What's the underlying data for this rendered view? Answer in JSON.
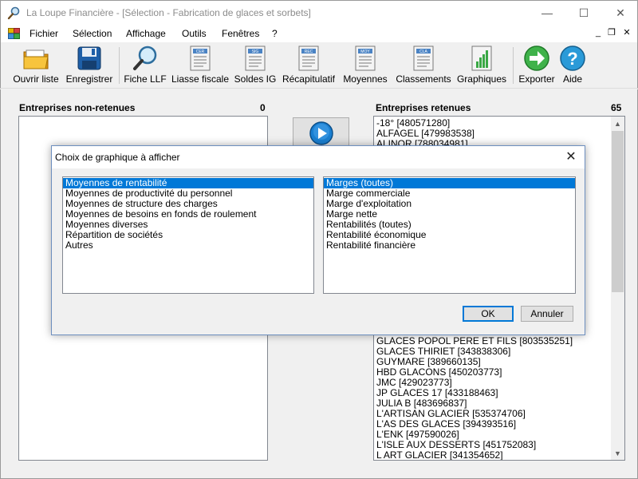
{
  "window": {
    "title": "La Loupe Financière - [Sélection - Fabrication de glaces et sorbets]",
    "minimize": "—",
    "maximize": "☐",
    "close": "✕"
  },
  "menu": {
    "items": [
      "Fichier",
      "Sélection",
      "Affichage",
      "Outils",
      "Fenêtres",
      "?"
    ],
    "mdi_minimize": "_",
    "mdi_restore": "❐",
    "mdi_close": "✕"
  },
  "toolbar": {
    "buttons": [
      {
        "label": "Ouvrir liste",
        "icon": "folder-icon"
      },
      {
        "label": "Enregistrer",
        "icon": "floppy-disk-icon"
      },
      {
        "label": "Fiche LLF",
        "icon": "magnifier-icon"
      },
      {
        "label": "Liasse fiscale",
        "icon": "document-cer-icon"
      },
      {
        "label": "Soldes IG",
        "icon": "document-sig-icon"
      },
      {
        "label": "Récapitulatif",
        "icon": "document-rec-icon"
      },
      {
        "label": "Moyennes",
        "icon": "document-moy-icon"
      },
      {
        "label": "Classements",
        "icon": "document-cla-icon"
      },
      {
        "label": "Graphiques",
        "icon": "bar-chart-icon"
      },
      {
        "label": "Exporter",
        "icon": "green-arrow-icon"
      },
      {
        "label": "Aide",
        "icon": "help-icon"
      }
    ],
    "doc_tags": {
      "cer": "CER",
      "sig": "SIG",
      "rec": "REC",
      "moy": "MOY",
      "cla": "CLA"
    }
  },
  "left_panel": {
    "title": "Entreprises non-retenues",
    "count": "0",
    "items": []
  },
  "right_panel": {
    "title": "Entreprises retenues",
    "count": "65",
    "items_top": [
      "-18° [480571280]",
      "ALFAGEL [479983538]",
      "ALINOR [788034981]"
    ],
    "items_bottom": [
      "GLACES POPOL PERE ET FILS [803535251]",
      "GLACES THIRIET [343838306]",
      "GUYMARE [389660135]",
      "HBD GLACONS [450203773]",
      "JMC [429023773]",
      "JP GLACES 17 [433188463]",
      "JULIA B [483696837]",
      "L'ARTISAN GLACIER [535374706]",
      "L'AS DES GLACES [394393516]",
      "L'ENK [497590026]",
      "L'ISLE AUX DESSERTS [451752083]",
      "L ART GLACIER [341354652]"
    ]
  },
  "dialog": {
    "title": "Choix de graphique à afficher",
    "close": "✕",
    "left_list": [
      "Moyennes de rentabilité",
      "Moyennes de productivité du personnel",
      "Moyennes de structure des charges",
      "Moyennes de besoins en fonds de roulement",
      "Moyennes diverses",
      "Répartition de sociétés",
      "Autres"
    ],
    "right_list": [
      "Marges (toutes)",
      "Marge commerciale",
      "Marge d'exploitation",
      "Marge nette",
      "Rentabilités (toutes)",
      "Rentabilité économique",
      "Rentabilité financière"
    ],
    "ok_label": "OK",
    "cancel_label": "Annuler"
  },
  "colors": {
    "selection": "#0078d7",
    "title_text": "#8c8c8c"
  }
}
